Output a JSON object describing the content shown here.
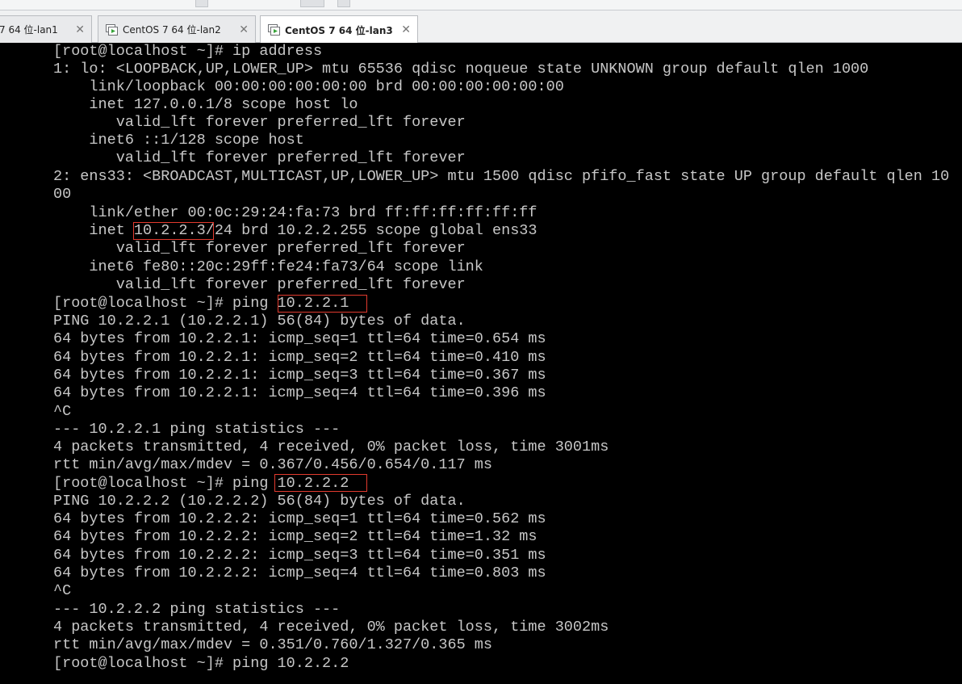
{
  "tabs": [
    {
      "label": "7 64 位-lan1"
    },
    {
      "label": "CentOS 7 64 位-lan2"
    },
    {
      "label": "CentOS 7 64 位-lan3"
    }
  ],
  "colors": {
    "terminal_bg": "#000000",
    "terminal_text": "#c7c7c7",
    "highlight_box": "#e23a2e"
  },
  "icons": {
    "tab_icon": "vm-play-icon",
    "close": "close-icon"
  },
  "terminal": {
    "lines": [
      "[root@localhost ~]# ip address",
      "1: lo: <LOOPBACK,UP,LOWER_UP> mtu 65536 qdisc noqueue state UNKNOWN group default qlen 1000",
      "    link/loopback 00:00:00:00:00:00 brd 00:00:00:00:00:00",
      "    inet 127.0.0.1/8 scope host lo",
      "       valid_lft forever preferred_lft forever",
      "    inet6 ::1/128 scope host",
      "       valid_lft forever preferred_lft forever",
      "2: ens33: <BROADCAST,MULTICAST,UP,LOWER_UP> mtu 1500 qdisc pfifo_fast state UP group default qlen 10",
      "00",
      "    link/ether 00:0c:29:24:fa:73 brd ff:ff:ff:ff:ff:ff",
      "    inet 10.2.2.3/24 brd 10.2.2.255 scope global ens33",
      "       valid_lft forever preferred_lft forever",
      "    inet6 fe80::20c:29ff:fe24:fa73/64 scope link",
      "       valid_lft forever preferred_lft forever",
      "[root@localhost ~]# ping 10.2.2.1",
      "PING 10.2.2.1 (10.2.2.1) 56(84) bytes of data.",
      "64 bytes from 10.2.2.1: icmp_seq=1 ttl=64 time=0.654 ms",
      "64 bytes from 10.2.2.1: icmp_seq=2 ttl=64 time=0.410 ms",
      "64 bytes from 10.2.2.1: icmp_seq=3 ttl=64 time=0.367 ms",
      "64 bytes from 10.2.2.1: icmp_seq=4 ttl=64 time=0.396 ms",
      "^C",
      "--- 10.2.2.1 ping statistics ---",
      "4 packets transmitted, 4 received, 0% packet loss, time 3001ms",
      "rtt min/avg/max/mdev = 0.367/0.456/0.654/0.117 ms",
      "[root@localhost ~]# ping 10.2.2.2",
      "PING 10.2.2.2 (10.2.2.2) 56(84) bytes of data.",
      "64 bytes from 10.2.2.2: icmp_seq=1 ttl=64 time=0.562 ms",
      "64 bytes from 10.2.2.2: icmp_seq=2 ttl=64 time=1.32 ms",
      "64 bytes from 10.2.2.2: icmp_seq=3 ttl=64 time=0.351 ms",
      "64 bytes from 10.2.2.2: icmp_seq=4 ttl=64 time=0.803 ms",
      "^C",
      "--- 10.2.2.2 ping statistics ---",
      "4 packets transmitted, 4 received, 0% packet loss, time 3002ms",
      "rtt min/avg/max/mdev = 0.351/0.760/1.327/0.365 ms",
      "[root@localhost ~]# ping 10.2.2.2"
    ]
  }
}
